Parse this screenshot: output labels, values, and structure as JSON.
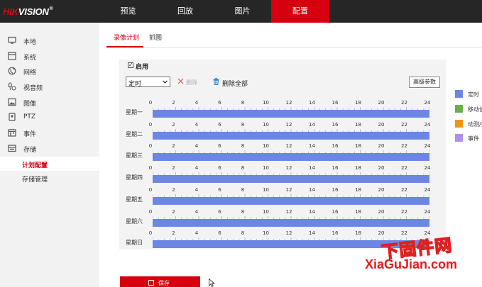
{
  "brand": {
    "hik": "HIK",
    "vision": "VISION",
    "reg": "®"
  },
  "nav": [
    {
      "label": "预览"
    },
    {
      "label": "回放"
    },
    {
      "label": "图片"
    },
    {
      "label": "配置"
    }
  ],
  "sidebar": {
    "items": [
      {
        "label": "本地",
        "icon": "monitor-icon"
      },
      {
        "label": "系统",
        "icon": "system-icon"
      },
      {
        "label": "网络",
        "icon": "globe-icon"
      },
      {
        "label": "视音频",
        "icon": "mic-icon"
      },
      {
        "label": "图像",
        "icon": "image-icon"
      },
      {
        "label": "PTZ",
        "icon": "ptz-icon"
      },
      {
        "label": "事件",
        "icon": "calendar-icon"
      },
      {
        "label": "存储",
        "icon": "storage-icon"
      }
    ],
    "sub_items": [
      {
        "label": "计划配置"
      },
      {
        "label": "存储管理"
      }
    ]
  },
  "tabs": [
    {
      "label": "录像计划"
    },
    {
      "label": "抓图"
    }
  ],
  "enable": {
    "label": "启用",
    "checked": true,
    "check_glyph": "✓"
  },
  "toolbar": {
    "mode_select": "定时",
    "delete_label": "删除",
    "delete_all_label": "删除全部",
    "advanced_label": "高级参数"
  },
  "schedule": {
    "days": [
      "星期一",
      "星期二",
      "星期三",
      "星期四",
      "星期五",
      "星期六",
      "星期日"
    ],
    "hour_ticks": [
      "0",
      "2",
      "4",
      "6",
      "8",
      "10",
      "12",
      "14",
      "16",
      "18",
      "20",
      "22",
      "24"
    ],
    "coverage": "00:00-24:00",
    "bar_color": "#6b87e3"
  },
  "legend": [
    {
      "label": "定时",
      "color": "#6b87e3"
    },
    {
      "label": "移动侦",
      "color": "#6dae4a"
    },
    {
      "label": "动测/报",
      "color": "#f0960f"
    },
    {
      "label": "事件",
      "color": "#b08fe8"
    }
  ],
  "save": {
    "label": "保存"
  },
  "watermark": {
    "cn": "下固件网",
    "en": "XiaGuJian.com"
  },
  "colors": {
    "accent": "#d7000f",
    "topbar": "#262626"
  }
}
